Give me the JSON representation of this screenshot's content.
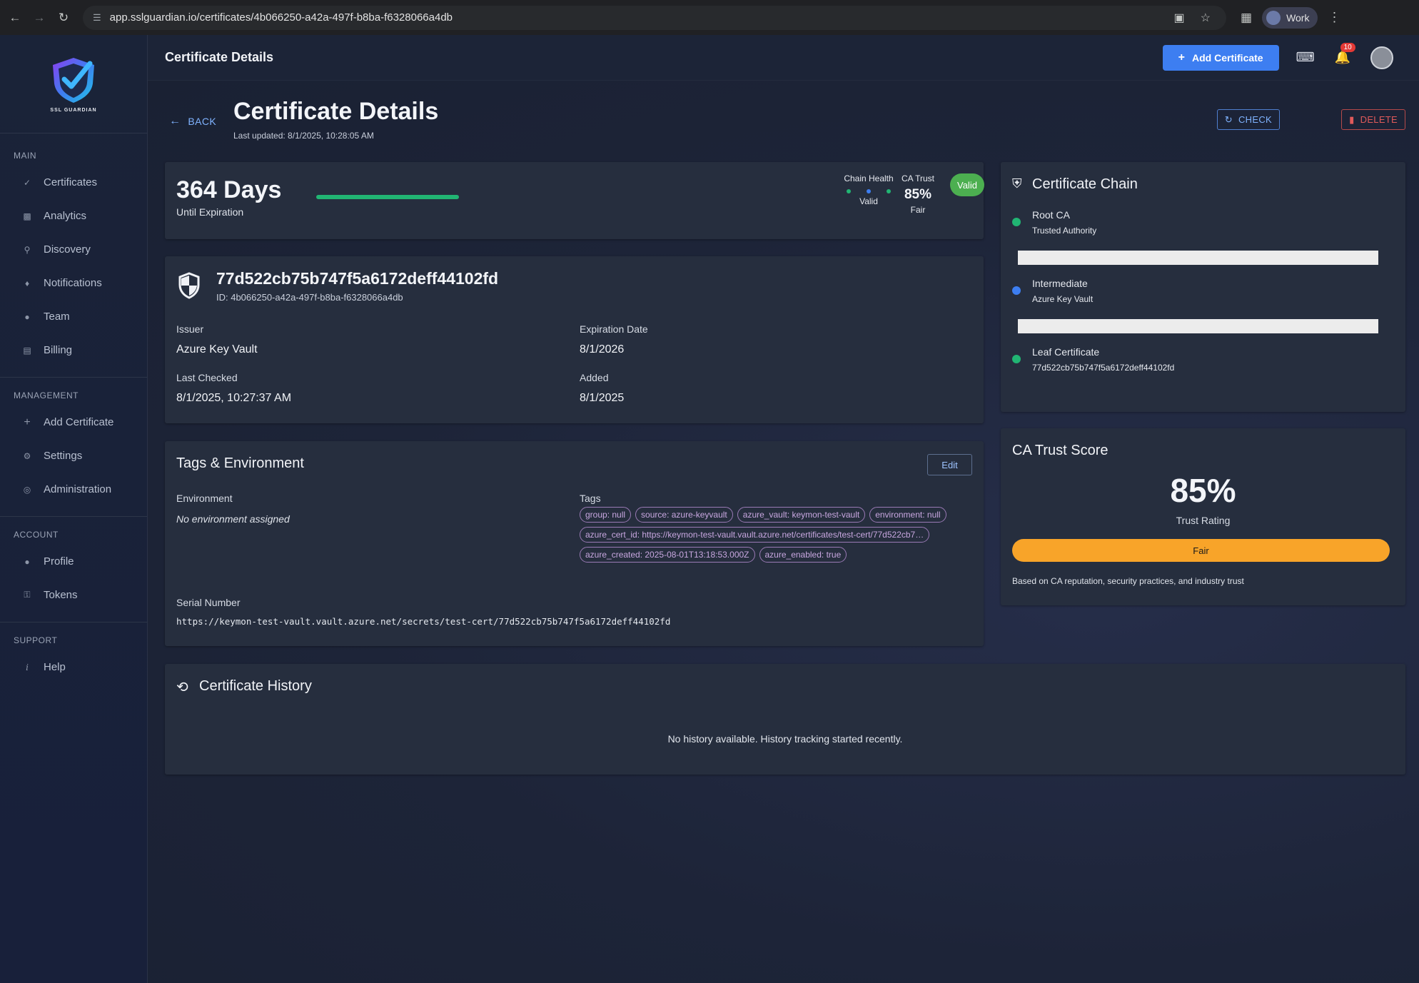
{
  "browser": {
    "url": "app.sslguardian.io/certificates/4b066250-a42a-497f-b8ba-f6328066a4db",
    "profile_label": "Work"
  },
  "sidebar": {
    "logo_text": "SSL GUARDIAN",
    "sections": [
      {
        "title": "MAIN",
        "items": [
          {
            "label": "Certificates",
            "icon": "badge-check-icon"
          },
          {
            "label": "Analytics",
            "icon": "bar-chart-icon"
          },
          {
            "label": "Discovery",
            "icon": "search-icon"
          },
          {
            "label": "Notifications",
            "icon": "bell-icon"
          },
          {
            "label": "Team",
            "icon": "person-icon"
          },
          {
            "label": "Billing",
            "icon": "credit-card-icon"
          }
        ]
      },
      {
        "title": "MANAGEMENT",
        "items": [
          {
            "label": "Add Certificate",
            "icon": "plus-icon"
          },
          {
            "label": "Settings",
            "icon": "gear-icon"
          },
          {
            "label": "Administration",
            "icon": "admin-icon"
          }
        ]
      },
      {
        "title": "ACCOUNT",
        "items": [
          {
            "label": "Profile",
            "icon": "person-icon"
          },
          {
            "label": "Tokens",
            "icon": "key-icon"
          }
        ]
      },
      {
        "title": "SUPPORT",
        "items": [
          {
            "label": "Help",
            "icon": "info-icon"
          }
        ]
      }
    ]
  },
  "header": {
    "title": "Certificate Details",
    "add_button": "Add Certificate",
    "notification_count": "10"
  },
  "page": {
    "back_label": "BACK",
    "title": "Certificate Details",
    "last_updated": "Last updated: 8/1/2025, 10:28:05 AM",
    "check_label": "CHECK",
    "delete_label": "DELETE"
  },
  "expiration": {
    "days": "364 Days",
    "subtitle": "Until Expiration",
    "progress": 1.0,
    "chain_health_label": "Chain Health",
    "chain_health_status": "Valid",
    "ca_trust_label": "CA Trust",
    "ca_trust_pct": "85%",
    "ca_trust_rating": "Fair",
    "status_badge": "Valid"
  },
  "certificate": {
    "name": "77d522cb75b747f5a6172deff44102fd",
    "id_line": "ID: 4b066250-a42a-497f-b8ba-f6328066a4db",
    "issuer_label": "Issuer",
    "issuer": "Azure Key Vault",
    "expiration_label": "Expiration Date",
    "expiration": "8/1/2026",
    "last_checked_label": "Last Checked",
    "last_checked": "8/1/2025, 10:27:37 AM",
    "added_label": "Added",
    "added": "8/1/2025"
  },
  "tags_section": {
    "title": "Tags & Environment",
    "edit_label": "Edit",
    "environment_label": "Environment",
    "environment_value": "No environment assigned",
    "tags_label": "Tags",
    "tags": [
      "group: null",
      "source: azure-keyvault",
      "azure_vault: keymon-test-vault",
      "environment: null",
      "azure_cert_id: https://keymon-test-vault.vault.azure.net/certificates/test-cert/77d522cb7…",
      "azure_created: 2025-08-01T13:18:53.000Z",
      "azure_enabled: true"
    ],
    "serial_label": "Serial Number",
    "serial_value": "https://keymon-test-vault.vault.azure.net/secrets/test-cert/77d522cb75b747f5a6172deff44102fd"
  },
  "history": {
    "title": "Certificate History",
    "empty_message": "No history available. History tracking started recently."
  },
  "chain": {
    "title": "Certificate Chain",
    "nodes": [
      {
        "title": "Root CA",
        "subtitle": "Trusted Authority",
        "color": "#21b573"
      },
      {
        "title": "Intermediate",
        "subtitle": "Azure Key Vault",
        "color": "#3d7ef1"
      },
      {
        "title": "Leaf Certificate",
        "subtitle": "77d522cb75b747f5a6172deff44102fd",
        "color": "#21b573"
      }
    ]
  },
  "trust_score": {
    "title": "CA Trust Score",
    "pct": "85%",
    "subtitle": "Trust Rating",
    "rating": "Fair",
    "note": "Based on CA reputation, security practices, and industry trust"
  },
  "colors": {
    "accent": "#3d7ef1",
    "success": "#21b573",
    "warning": "#f8a429",
    "danger": "#e05a5a",
    "tag": "#c8a7e0"
  }
}
